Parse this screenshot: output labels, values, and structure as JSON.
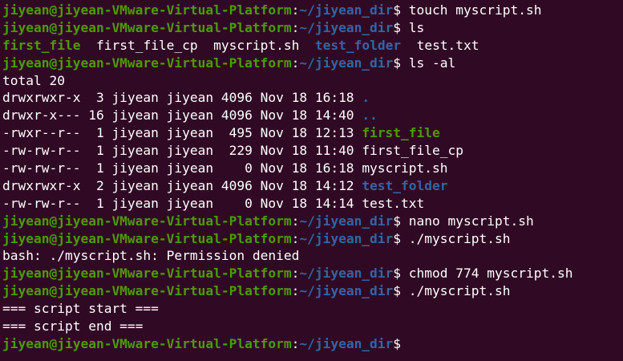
{
  "prompt": {
    "user": "jiyean@jiyean-VMware-Virtual-Platform",
    "sep": ":",
    "path": "~/jiyean_dir",
    "dollar": "$"
  },
  "colors": {
    "background": "#300a24",
    "user_green": "#4e9a06",
    "path_blue": "#3465a4",
    "text": "#ffffff"
  },
  "lines": [
    {
      "type": "prompt",
      "cmd": " touch myscript.sh"
    },
    {
      "type": "prompt",
      "cmd": " ls"
    },
    {
      "type": "ls",
      "items": [
        {
          "name": "first_file",
          "kind": "exec",
          "pad": "  "
        },
        {
          "name": "first_file_cp",
          "kind": "plain",
          "pad": "  "
        },
        {
          "name": "myscript.sh",
          "kind": "plain",
          "pad": "  "
        },
        {
          "name": "test_folder",
          "kind": "dir",
          "pad": "  "
        },
        {
          "name": "test.txt",
          "kind": "plain",
          "pad": ""
        }
      ]
    },
    {
      "type": "prompt",
      "cmd": " ls -al"
    },
    {
      "type": "text",
      "text": "total 20"
    },
    {
      "type": "ll",
      "meta": "drwxrwxr-x  3 jiyean jiyean 4096 Nov 18 16:18 ",
      "name": ".",
      "kind": "dir"
    },
    {
      "type": "ll",
      "meta": "drwxr-x--- 16 jiyean jiyean 4096 Nov 18 14:40 ",
      "name": "..",
      "kind": "dir"
    },
    {
      "type": "ll",
      "meta": "-rwxr--r--  1 jiyean jiyean  495 Nov 18 12:13 ",
      "name": "first_file",
      "kind": "exec"
    },
    {
      "type": "ll",
      "meta": "-rw-rw-r--  1 jiyean jiyean  229 Nov 18 11:40 ",
      "name": "first_file_cp",
      "kind": "plain"
    },
    {
      "type": "ll",
      "meta": "-rw-rw-r--  1 jiyean jiyean    0 Nov 18 16:18 ",
      "name": "myscript.sh",
      "kind": "plain"
    },
    {
      "type": "ll",
      "meta": "drwxrwxr-x  2 jiyean jiyean 4096 Nov 18 14:12 ",
      "name": "test_folder",
      "kind": "dir"
    },
    {
      "type": "ll",
      "meta": "-rw-rw-r--  1 jiyean jiyean    0 Nov 18 14:14 ",
      "name": "test.txt",
      "kind": "plain"
    },
    {
      "type": "prompt",
      "cmd": " nano myscript.sh"
    },
    {
      "type": "prompt",
      "cmd": " ./myscript.sh"
    },
    {
      "type": "text",
      "text": "bash: ./myscript.sh: Permission denied"
    },
    {
      "type": "prompt",
      "cmd": " chmod 774 myscript.sh"
    },
    {
      "type": "prompt",
      "cmd": " ./myscript.sh"
    },
    {
      "type": "text",
      "text": "=== script start ==="
    },
    {
      "type": "text",
      "text": "=== script end ==="
    },
    {
      "type": "prompt",
      "cmd": ""
    }
  ]
}
